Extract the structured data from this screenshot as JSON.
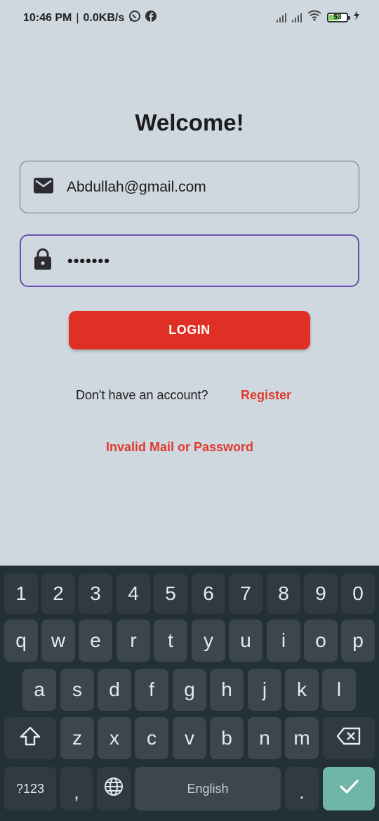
{
  "status_bar": {
    "time": "10:46 PM",
    "separator": "|",
    "net_speed": "0.0KB/s",
    "notification_icons": [
      "whatsapp-icon",
      "facebook-icon"
    ],
    "battery_level": "53",
    "charging": true
  },
  "login": {
    "title": "Welcome!",
    "email_icon": "mail-icon",
    "email_value": "Abdullah@gmail.com",
    "password_icon": "lock-icon",
    "password_value": "•••••••",
    "login_button": "LOGIN",
    "no_account_text": "Don't have an account?",
    "register_link": "Register",
    "error_message": "Invalid Mail or Password"
  },
  "keyboard": {
    "number_row": [
      "1",
      "2",
      "3",
      "4",
      "5",
      "6",
      "7",
      "8",
      "9",
      "0"
    ],
    "row1": [
      "q",
      "w",
      "e",
      "r",
      "t",
      "y",
      "u",
      "i",
      "o",
      "p"
    ],
    "row2": [
      "a",
      "s",
      "d",
      "f",
      "g",
      "h",
      "j",
      "k",
      "l"
    ],
    "row3": [
      "z",
      "x",
      "c",
      "v",
      "b",
      "n",
      "m"
    ],
    "symbols_key": "?123",
    "comma_key": ",",
    "space_label": "English",
    "period_key": ".",
    "shift_icon": "shift-icon",
    "backspace_icon": "backspace-icon",
    "globe_icon": "globe-icon",
    "enter_icon": "check-icon",
    "accent_color": "#6fb5a8"
  },
  "colors": {
    "background": "#cfd8df",
    "primary_button": "#e03025",
    "focus_border": "#6a4fb3",
    "link": "#e03a2e"
  }
}
